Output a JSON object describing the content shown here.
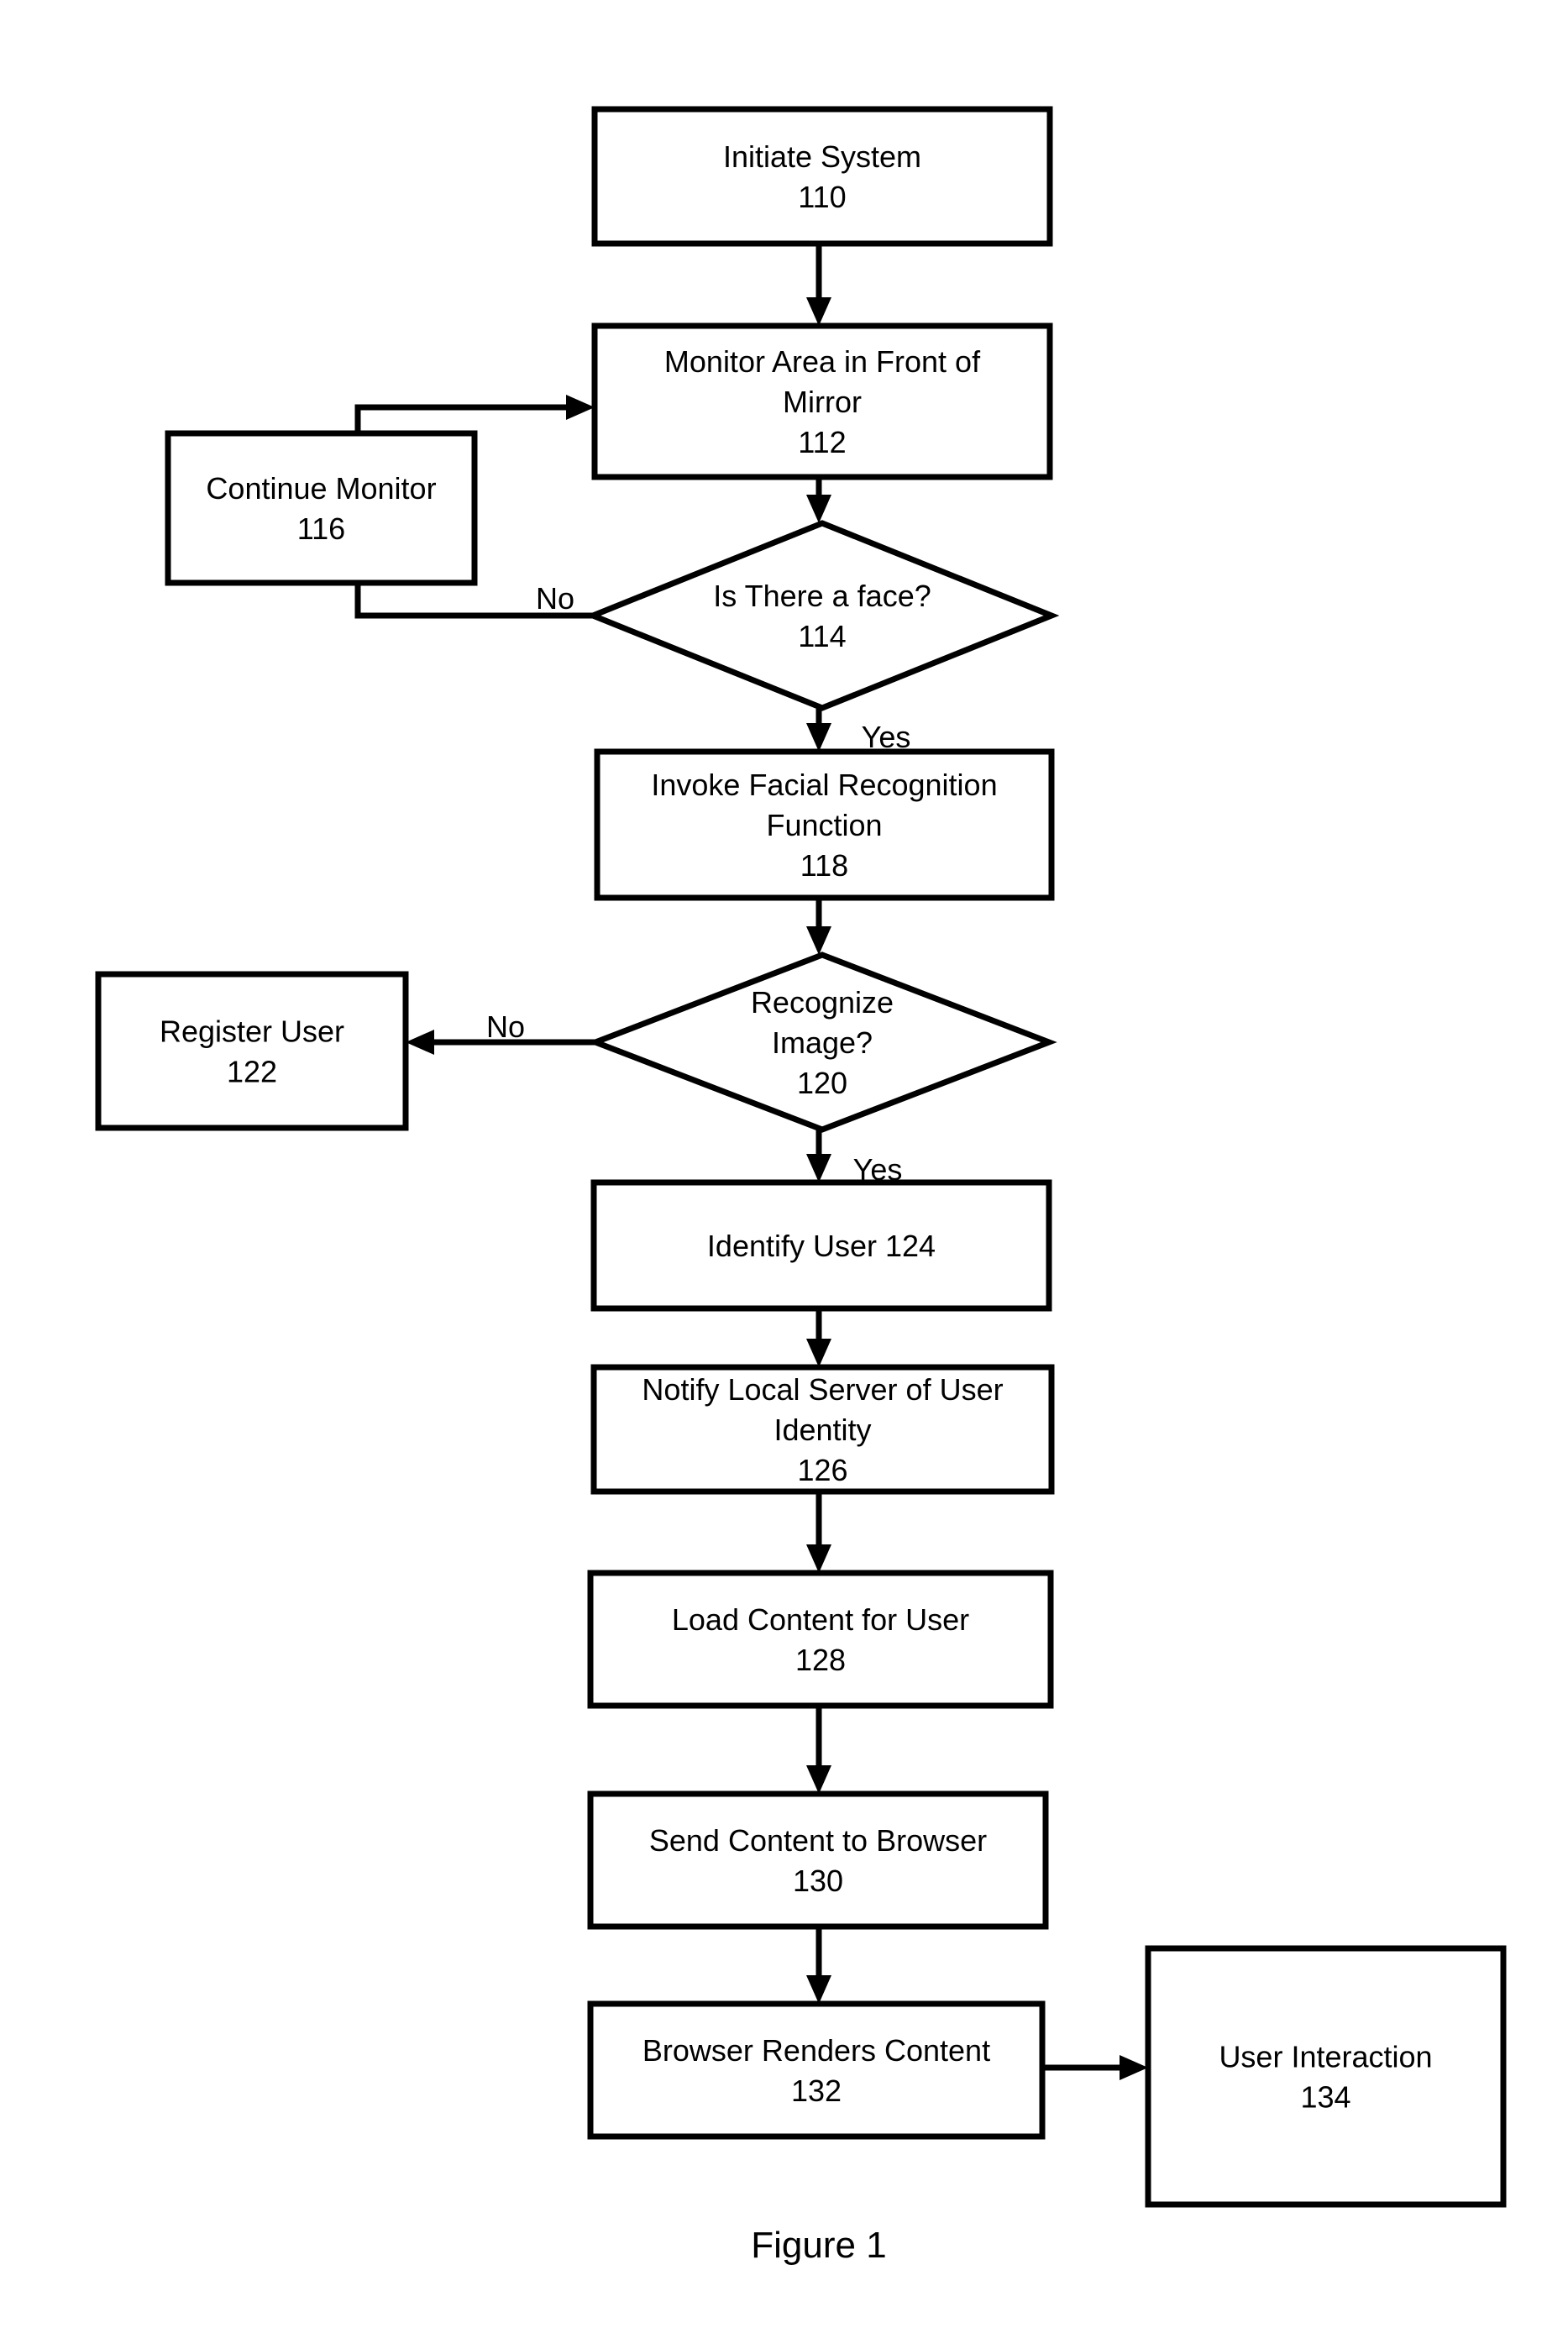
{
  "figure": {
    "caption": "Figure 1",
    "nodes": [
      {
        "id": "110",
        "type": "process",
        "lines": [
          "Initiate System",
          "110"
        ]
      },
      {
        "id": "112",
        "type": "process",
        "lines": [
          "Monitor Area in Front of",
          "Mirror",
          "112"
        ]
      },
      {
        "id": "114",
        "type": "decision",
        "lines": [
          "Is There a face?",
          "114"
        ]
      },
      {
        "id": "116",
        "type": "process",
        "lines": [
          "Continue Monitor",
          "116"
        ]
      },
      {
        "id": "118",
        "type": "process",
        "lines": [
          "Invoke Facial Recognition",
          "Function",
          "118"
        ]
      },
      {
        "id": "120",
        "type": "decision",
        "lines": [
          "Recognize",
          "Image?",
          "120"
        ]
      },
      {
        "id": "122",
        "type": "process",
        "lines": [
          "Register User",
          "122"
        ]
      },
      {
        "id": "124",
        "type": "process",
        "lines": [
          "Identify User 124"
        ]
      },
      {
        "id": "126",
        "type": "process",
        "lines": [
          "Notify Local Server of User",
          "Identity",
          "126"
        ]
      },
      {
        "id": "128",
        "type": "process",
        "lines": [
          "Load Content for User",
          "128"
        ]
      },
      {
        "id": "130",
        "type": "process",
        "lines": [
          "Send Content to Browser",
          "130"
        ]
      },
      {
        "id": "132",
        "type": "process",
        "lines": [
          "Browser Renders Content",
          "132"
        ]
      },
      {
        "id": "134",
        "type": "process",
        "lines": [
          "User Interaction",
          "134"
        ]
      }
    ],
    "edges": [
      {
        "from": "110",
        "to": "112",
        "label": ""
      },
      {
        "from": "112",
        "to": "114",
        "label": ""
      },
      {
        "from": "114",
        "to": "116",
        "label": "No"
      },
      {
        "from": "116",
        "to": "112",
        "label": ""
      },
      {
        "from": "114",
        "to": "118",
        "label": "Yes"
      },
      {
        "from": "118",
        "to": "120",
        "label": ""
      },
      {
        "from": "120",
        "to": "122",
        "label": "No"
      },
      {
        "from": "120",
        "to": "124",
        "label": "Yes"
      },
      {
        "from": "124",
        "to": "126",
        "label": ""
      },
      {
        "from": "126",
        "to": "128",
        "label": ""
      },
      {
        "from": "128",
        "to": "130",
        "label": ""
      },
      {
        "from": "130",
        "to": "132",
        "label": ""
      },
      {
        "from": "132",
        "to": "134",
        "label": ""
      }
    ]
  }
}
